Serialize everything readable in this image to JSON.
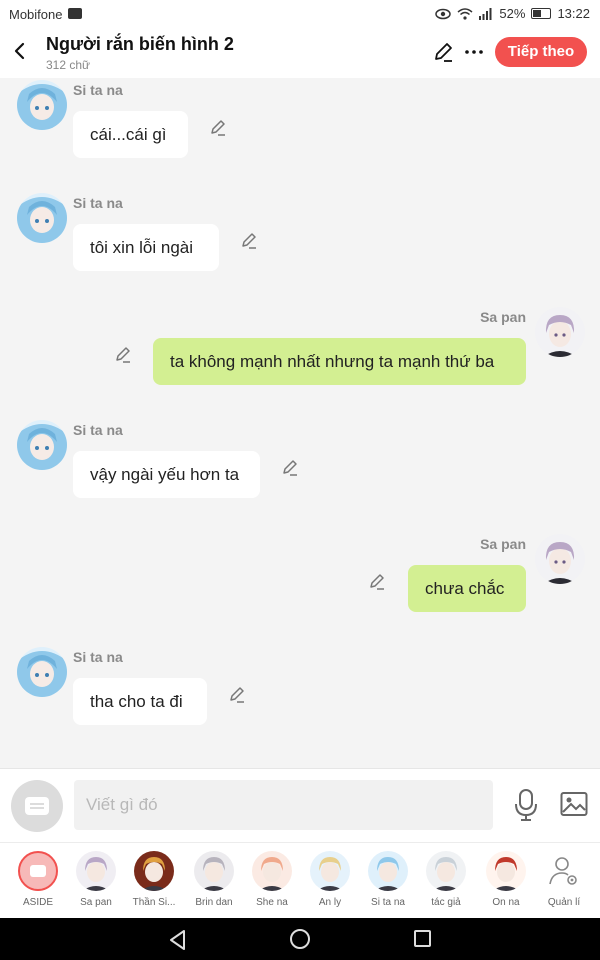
{
  "status_bar": {
    "carrier": "Mobifone",
    "battery": "52%",
    "battery_level": 0.52,
    "time": "13:22"
  },
  "header": {
    "title": "Người rắn biến hình 2",
    "word_count": "312 chữ",
    "next_label": "Tiếp theo"
  },
  "messages": [
    {
      "side": "left",
      "speaker": "Si ta na",
      "text": "cái...cái gì"
    },
    {
      "side": "left",
      "speaker": "Si ta na",
      "text": "tôi xin lỗi ngài"
    },
    {
      "side": "right",
      "speaker": "Sa pan",
      "text": "ta không mạnh nhất nhưng ta mạnh thứ ba"
    },
    {
      "side": "left",
      "speaker": "Si ta na",
      "text": "vậy ngài yếu hơn ta"
    },
    {
      "side": "right",
      "speaker": "Sa pan",
      "text": "chưa chắc"
    },
    {
      "side": "left",
      "speaker": "Si ta na",
      "text": "tha cho ta đi"
    }
  ],
  "composer": {
    "placeholder": "Viết gì đó"
  },
  "characters": [
    {
      "label": "ASIDE",
      "selected": true
    },
    {
      "label": "Sa pan"
    },
    {
      "label": "Thần Si..."
    },
    {
      "label": "Brin dan"
    },
    {
      "label": "She na"
    },
    {
      "label": "An ly"
    },
    {
      "label": "Si ta na"
    },
    {
      "label": "tác giả"
    },
    {
      "label": "On na"
    },
    {
      "label": "Quản lí"
    }
  ],
  "colors": {
    "accent": "#f2514f",
    "right_bubble": "#d3ef92",
    "left_bubble": "#ffffff",
    "background": "#f4f4f4"
  }
}
